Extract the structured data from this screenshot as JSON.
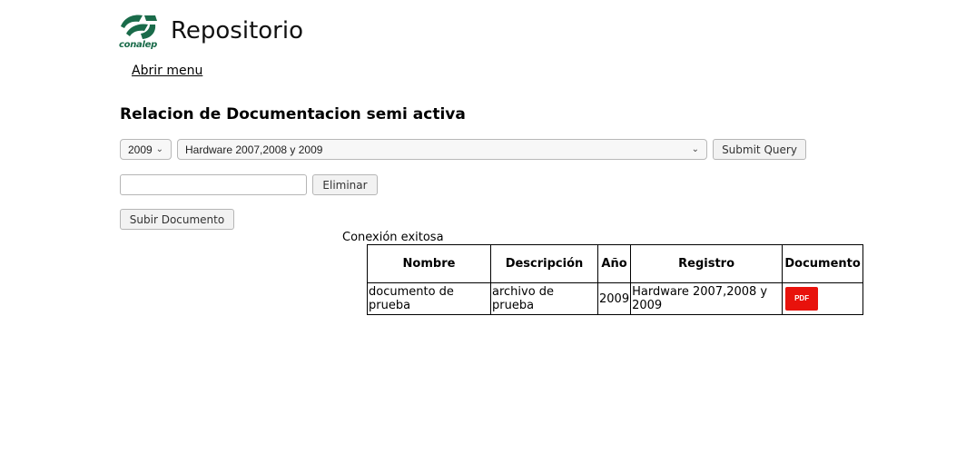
{
  "header": {
    "logo_text": "conalep",
    "title": "Repositorio",
    "menu_link": "Abrir menu"
  },
  "page": {
    "heading": "Relacion de Documentacion semi activa"
  },
  "filters": {
    "year_selected": "2009",
    "category_selected": "Hardware 2007,2008 y 2009",
    "submit_label": "Submit Query"
  },
  "delete": {
    "input_value": "",
    "button_label": "Eliminar"
  },
  "upload": {
    "button_label": "Subir Documento"
  },
  "status_text": "Conexión exitosa",
  "table": {
    "headers": [
      "Nombre",
      "Descripción",
      "Año",
      "Registro",
      "Documento"
    ],
    "rows": [
      {
        "nombre": "documento de prueba",
        "descripcion": "archivo de prueba",
        "anio": "2009",
        "registro": "Hardware 2007,2008 y 2009",
        "documento": "PDF"
      }
    ]
  },
  "colors": {
    "brand_green": "#1a6b4a",
    "pdf_red": "#e8120c"
  }
}
